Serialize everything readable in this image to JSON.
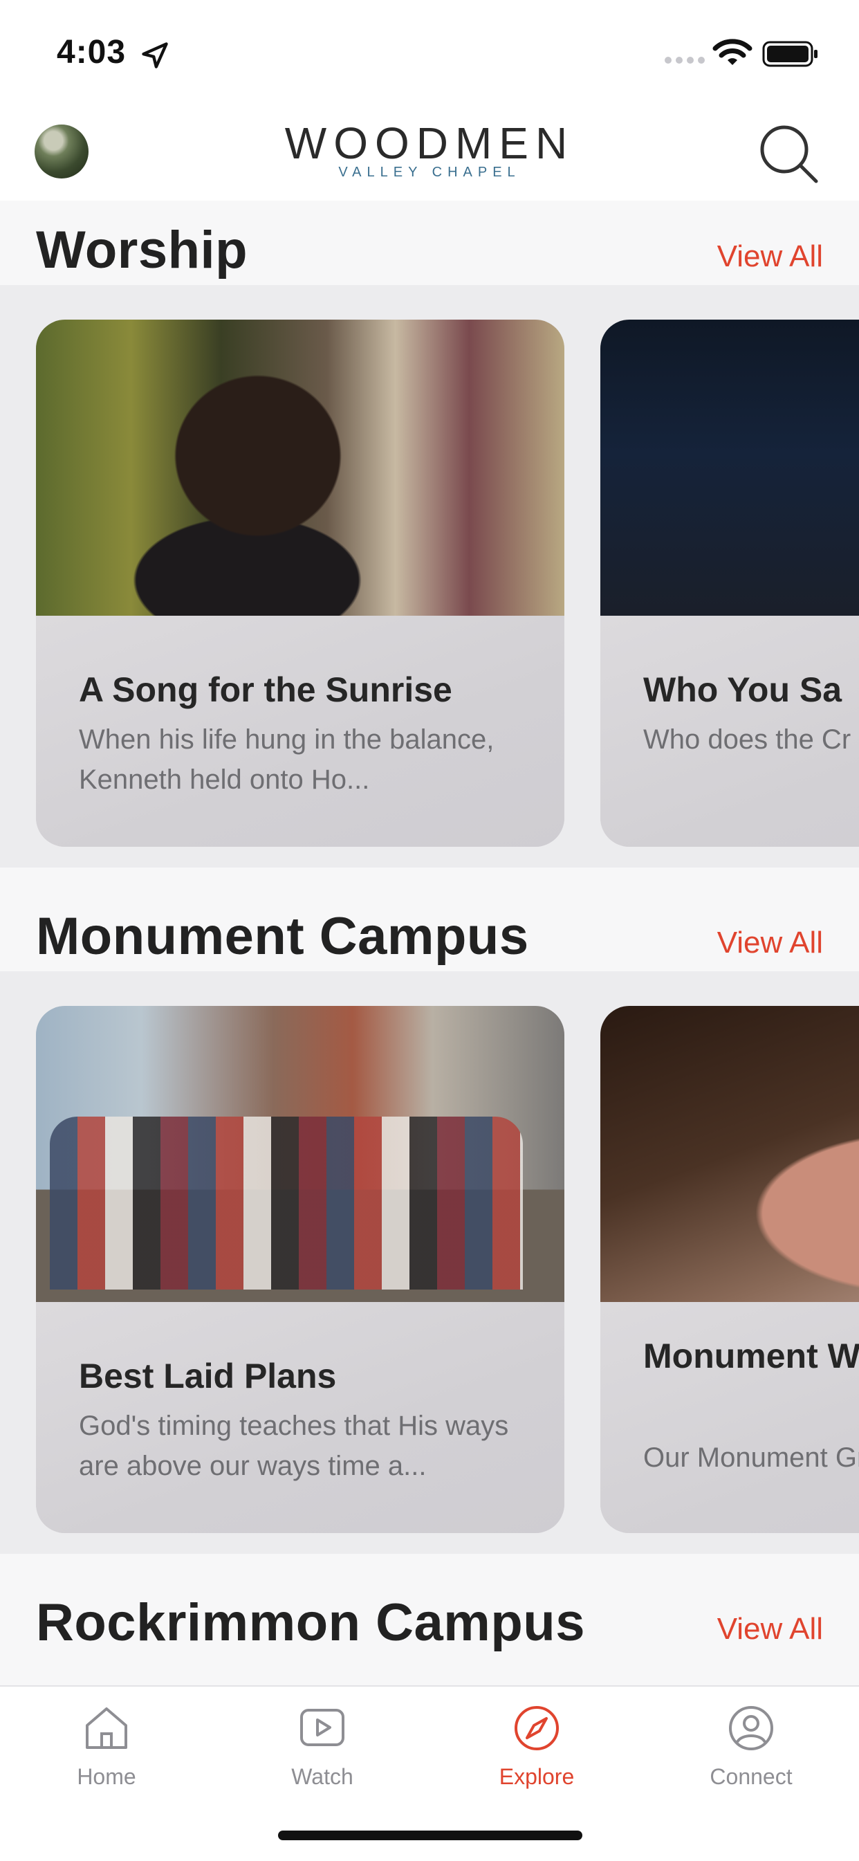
{
  "status_bar": {
    "time": "4:03"
  },
  "header": {
    "logo_main": "WOODMEN",
    "logo_sub": "VALLEY CHAPEL"
  },
  "sections": [
    {
      "title": "Worship",
      "view_all": "View All",
      "cards": [
        {
          "title": "A Song for the Sunrise",
          "description": "When his life hung in the balance, Kenneth held onto Ho..."
        },
        {
          "title": "Who You Sa",
          "description": "Who does the Cr soul say you are?"
        }
      ]
    },
    {
      "title": "Monument Campus",
      "view_all": "View All",
      "cards": [
        {
          "title": "Best Laid Plans",
          "description": "God's timing teaches that His ways are above our ways time a..."
        },
        {
          "title": "Monument Wednesday",
          "description": "Our Monument Greater Europe M"
        }
      ]
    },
    {
      "title": "Rockrimmon Campus",
      "view_all": "View All"
    }
  ],
  "tabs": [
    {
      "label": "Home",
      "icon": "home-icon",
      "active": false
    },
    {
      "label": "Watch",
      "icon": "play-icon",
      "active": false
    },
    {
      "label": "Explore",
      "icon": "compass-icon",
      "active": true
    },
    {
      "label": "Connect",
      "icon": "user-icon",
      "active": false
    }
  ],
  "colors": {
    "accent": "#e0442e",
    "text": "#222222",
    "muted": "#8e8e93",
    "logo_sub": "#3a6f8f"
  }
}
